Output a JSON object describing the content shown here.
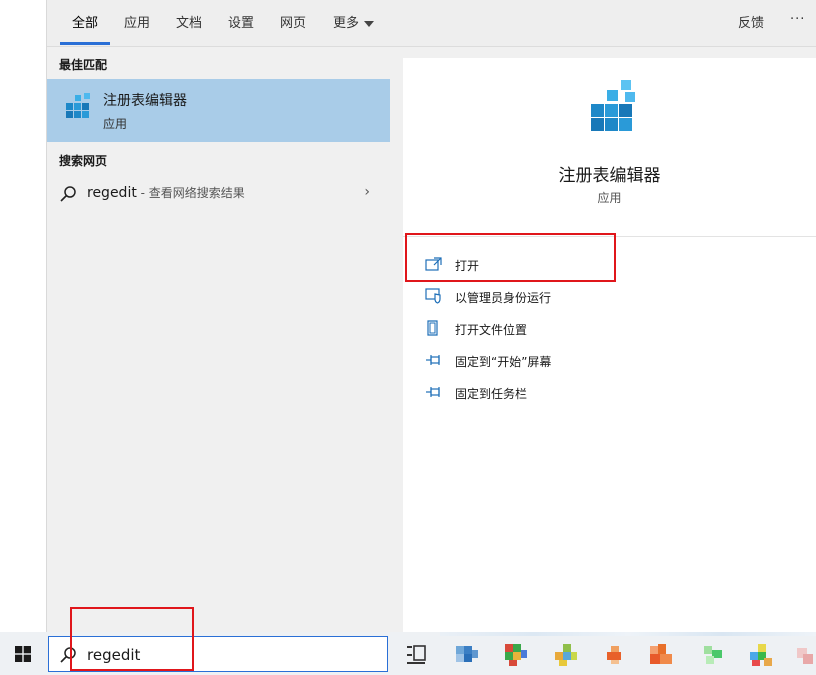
{
  "tabs": {
    "all": "全部",
    "apps": "应用",
    "documents": "文档",
    "settings": "设置",
    "web": "网页",
    "more": "更多",
    "feedback": "反馈",
    "ellipsis": "···"
  },
  "best_match": {
    "section_label": "最佳匹配",
    "title": "注册表编辑器",
    "subtitle": "应用",
    "icon": "registry-editor-icon"
  },
  "web_search": {
    "section_label": "搜索网页",
    "query": "regedit",
    "suffix": " - 查看网络搜索结果"
  },
  "detail": {
    "title": "注册表编辑器",
    "subtitle": "应用",
    "actions": [
      {
        "label": "打开",
        "icon": "open-icon"
      },
      {
        "label": "以管理员身份运行",
        "icon": "shield-icon"
      },
      {
        "label": "打开文件位置",
        "icon": "file-location-icon"
      },
      {
        "label": "固定到“开始”屏幕",
        "icon": "pin-icon"
      },
      {
        "label": "固定到任务栏",
        "icon": "pin-icon"
      }
    ]
  },
  "taskbar": {
    "search_value": "regedit"
  },
  "colors": {
    "accent": "#2a6fd6",
    "selection": "#a9cce8",
    "highlight_box": "#e0161b"
  }
}
